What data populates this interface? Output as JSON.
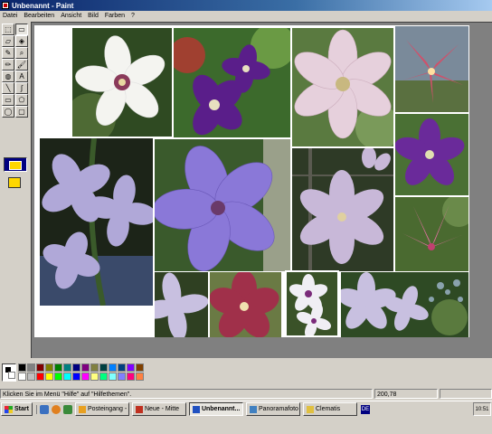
{
  "window": {
    "title": "Unbenannt - Paint"
  },
  "menu": [
    "Datei",
    "Bearbeiten",
    "Ansicht",
    "Bild",
    "Farben",
    "?"
  ],
  "tools": [
    {
      "name": "free-select",
      "glyph": "⬚"
    },
    {
      "name": "select",
      "glyph": "▭"
    },
    {
      "name": "eraser",
      "glyph": "▱"
    },
    {
      "name": "fill",
      "glyph": "◈"
    },
    {
      "name": "pick-color",
      "glyph": "✎"
    },
    {
      "name": "magnifier",
      "glyph": "⌕"
    },
    {
      "name": "pencil",
      "glyph": "✏"
    },
    {
      "name": "brush",
      "glyph": "🖌"
    },
    {
      "name": "airbrush",
      "glyph": "◍"
    },
    {
      "name": "text",
      "glyph": "A"
    },
    {
      "name": "line",
      "glyph": "╲"
    },
    {
      "name": "curve",
      "glyph": "∫"
    },
    {
      "name": "rectangle",
      "glyph": "▭"
    },
    {
      "name": "polygon",
      "glyph": "⬠"
    },
    {
      "name": "ellipse",
      "glyph": "◯"
    },
    {
      "name": "rounded-rect",
      "glyph": "▢"
    }
  ],
  "palette": [
    "#000000",
    "#808080",
    "#800000",
    "#808000",
    "#008000",
    "#008080",
    "#000080",
    "#800080",
    "#808040",
    "#004040",
    "#0080ff",
    "#004080",
    "#8000ff",
    "#804000",
    "#ffffff",
    "#c0c0c0",
    "#ff0000",
    "#ffff00",
    "#00ff00",
    "#00ffff",
    "#0000ff",
    "#ff00ff",
    "#ffff80",
    "#00ff80",
    "#80ffff",
    "#8080ff",
    "#ff0080",
    "#ff8040"
  ],
  "status": {
    "text": "Klicken Sie im Menü \"Hilfe\" auf \"Hilfethemen\".",
    "coords": "200,78"
  },
  "taskbar": {
    "start": "Start",
    "tasks": [
      {
        "label": "Posteingang -",
        "color": "#e8a020",
        "active": false
      },
      {
        "label": "Neue - Mitte",
        "color": "#c03020",
        "active": false
      },
      {
        "label": "Unbenannt...",
        "color": "#2050c0",
        "active": true
      },
      {
        "label": "Panoramafoto",
        "color": "#4080c0",
        "active": false
      },
      {
        "label": "Clematis",
        "color": "#e0c040",
        "active": false
      }
    ],
    "language": "DE",
    "clock": "10:51"
  }
}
